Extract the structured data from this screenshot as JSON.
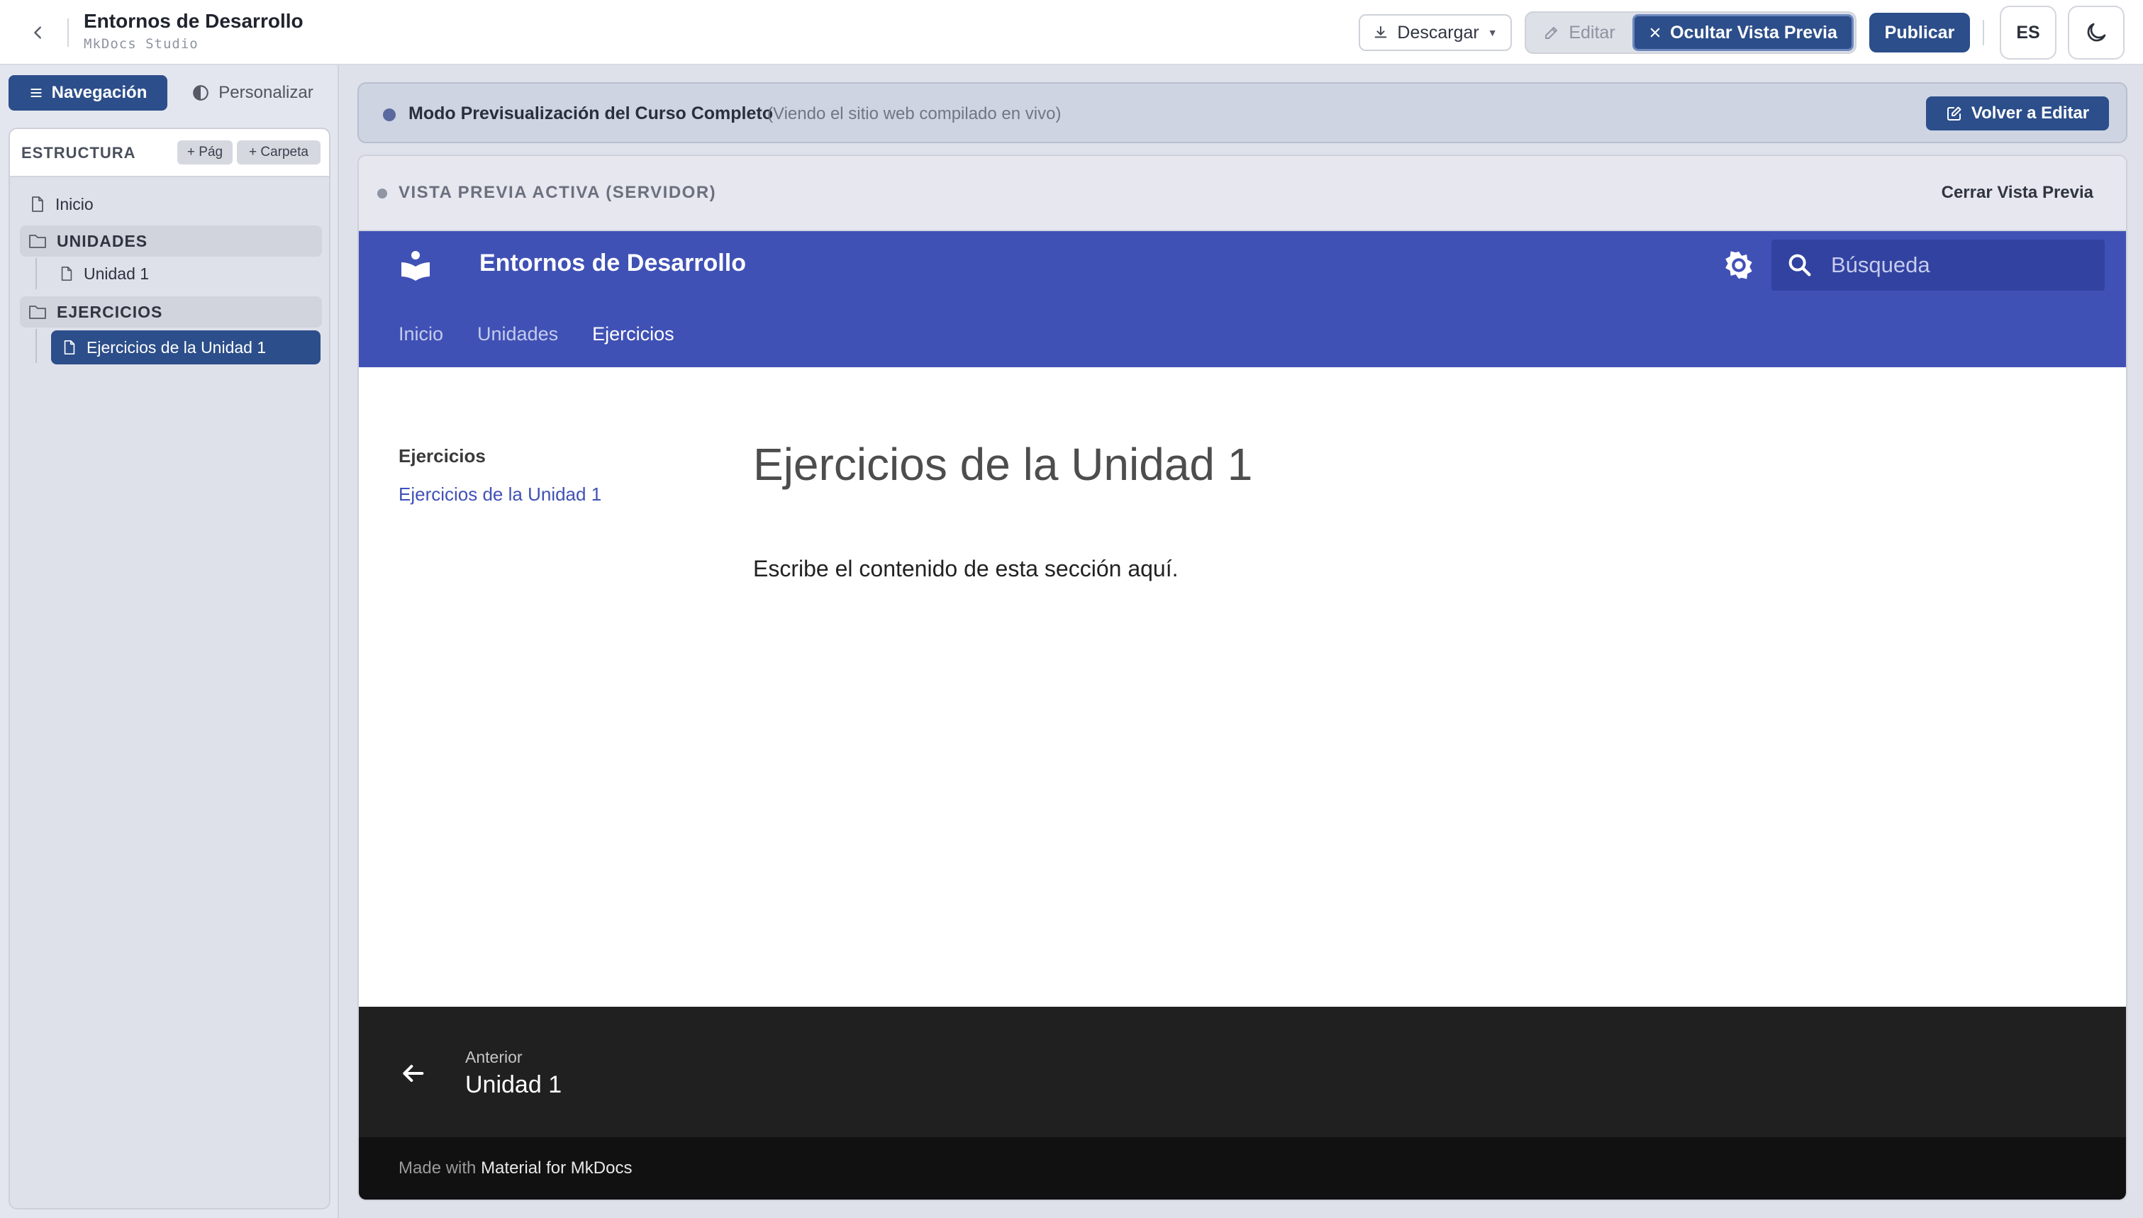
{
  "topbar": {
    "title": "Entornos de Desarrollo",
    "subtitle": "MkDocs Studio",
    "download_label": "Descargar",
    "edit_label": "Editar",
    "hide_preview_label": "Ocultar Vista Previa",
    "publish_label": "Publicar",
    "lang_label": "ES"
  },
  "sidebar": {
    "tabs": [
      {
        "label": "Navegación",
        "icon": "menu-icon",
        "active": true
      },
      {
        "label": "Personalizar",
        "icon": "contrast-icon",
        "active": false
      }
    ],
    "structure_title": "ESTRUCTURA",
    "add_page_label": "+ Pág",
    "add_folder_label": "+ Carpeta",
    "tree": [
      {
        "type": "page",
        "label": "Inicio"
      },
      {
        "type": "folder",
        "label": "UNIDADES"
      },
      {
        "type": "page",
        "label": "Unidad 1",
        "child": true
      },
      {
        "type": "folder",
        "label": "EJERCICIOS"
      },
      {
        "type": "page",
        "label": "Ejercicios de la Unidad 1",
        "child": true,
        "active": true
      }
    ]
  },
  "banner": {
    "title": "Modo Previsualización del Curso Completo",
    "note": "(Viendo el sitio web compilado en vivo)",
    "back_to_edit_label": "Volver a Editar"
  },
  "preview": {
    "status_label": "VISTA PREVIA ACTIVA (SERVIDOR)",
    "close_label": "Cerrar Vista Previa"
  },
  "site": {
    "title": "Entornos de Desarrollo",
    "search_placeholder": "Búsqueda",
    "tabs": [
      {
        "label": "Inicio",
        "active": false
      },
      {
        "label": "Unidades",
        "active": false
      },
      {
        "label": "Ejercicios",
        "active": true
      }
    ],
    "side_nav_title": "Ejercicios",
    "side_nav_link": "Ejercicios de la Unidad 1",
    "page_title": "Ejercicios de la Unidad 1",
    "page_text": "Escribe el contenido de esta sección aquí.",
    "footer_prev_label": "Anterior",
    "footer_prev_title": "Unidad 1",
    "made_with_prefix": "Made with",
    "made_with_link": "Material for MkDocs",
    "header_color": "#4051b5"
  },
  "colors": {
    "accent": "#2c4e8a",
    "sidebar_bg": "#e4e6ef"
  }
}
